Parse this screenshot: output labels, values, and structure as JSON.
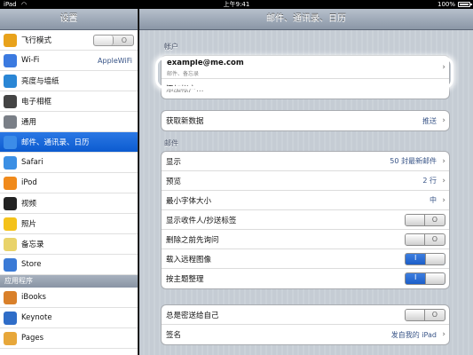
{
  "status": {
    "device": "iPad",
    "time": "上午9:41",
    "battery": "100%"
  },
  "left": {
    "title": "设置",
    "items": [
      {
        "label": "飞行模式",
        "icon": "airplane-icon",
        "color": "#e8a21b",
        "toggle": "off"
      },
      {
        "label": "Wi-Fi",
        "icon": "wifi-icon",
        "color": "#3b7ae0",
        "value": "AppleWiFi"
      },
      {
        "label": "亮度与墙纸",
        "icon": "brightness-icon",
        "color": "#2a86d5"
      },
      {
        "label": "电子相框",
        "icon": "picture-frame-icon",
        "color": "#444"
      },
      {
        "label": "通用",
        "icon": "gear-icon",
        "color": "#7a7f87"
      },
      {
        "label": "邮件、通讯录、日历",
        "icon": "mail-icon",
        "color": "#3c8ce8",
        "selected": true
      },
      {
        "label": "Safari",
        "icon": "safari-icon",
        "color": "#3b8fe4"
      },
      {
        "label": "iPod",
        "icon": "ipod-icon",
        "color": "#f08a1c"
      },
      {
        "label": "视频",
        "icon": "video-icon",
        "color": "#222"
      },
      {
        "label": "照片",
        "icon": "photos-icon",
        "color": "#f4c21a"
      },
      {
        "label": "备忘录",
        "icon": "notes-icon",
        "color": "#e9d36a"
      },
      {
        "label": "Store",
        "icon": "store-icon",
        "color": "#3a7ad6"
      }
    ],
    "apps_section": "应用程序",
    "apps": [
      {
        "label": "iBooks",
        "icon": "ibooks-icon",
        "color": "#d9802a"
      },
      {
        "label": "Keynote",
        "icon": "keynote-icon",
        "color": "#2f6dc8"
      },
      {
        "label": "Pages",
        "icon": "pages-icon",
        "color": "#e7a73a"
      }
    ],
    "toggle_off_glyph": "O"
  },
  "right": {
    "title": "邮件、通讯录、日历",
    "accounts_header": "帐户",
    "account": {
      "email": "example@me.com",
      "sub": "邮件、备忘录"
    },
    "add_account": "添加帐户…",
    "fetch": {
      "label": "获取新数据",
      "value": "推送"
    },
    "mail_header": "邮件",
    "mail_rows": [
      {
        "label": "显示",
        "value": "50 封最新邮件",
        "type": "chevron"
      },
      {
        "label": "预览",
        "value": "2 行",
        "type": "chevron"
      },
      {
        "label": "最小字体大小",
        "value": "中",
        "type": "chevron"
      },
      {
        "label": "显示收件人/抄送标签",
        "type": "switch",
        "state": "off"
      },
      {
        "label": "删除之前先询问",
        "type": "switch",
        "state": "off"
      },
      {
        "label": "载入远程图像",
        "type": "switch",
        "state": "on"
      },
      {
        "label": "按主题整理",
        "type": "switch",
        "state": "on"
      }
    ],
    "bcc_rows": [
      {
        "label": "总是密送给自己",
        "type": "switch",
        "state": "off"
      },
      {
        "label": "签名",
        "value": "发自我的 iPad",
        "type": "chevron"
      }
    ],
    "on_glyph": "I",
    "off_glyph": "O",
    "chevron": "›"
  }
}
